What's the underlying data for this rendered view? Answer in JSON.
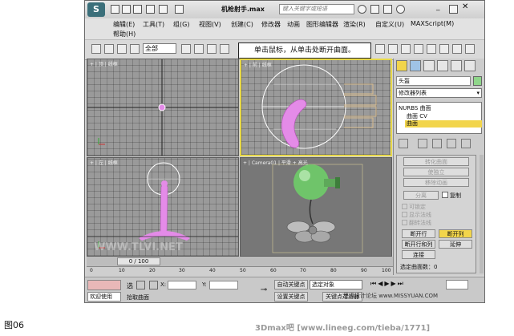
{
  "window": {
    "title": "机枪射手.max",
    "search_placeholder": "键入关键字或短语"
  },
  "menu": [
    "编辑(E)",
    "工具(T)",
    "组(G)",
    "视图(V)",
    "创建(C)",
    "修改器",
    "动画",
    "图形编辑器",
    "渲染(R)",
    "自定义(U)",
    "MAXScript(M)",
    "帮助(H)"
  ],
  "toolbar": {
    "selection_filter": "全部"
  },
  "callout": "单击鼠标，从单击处断开曲面。",
  "viewports": {
    "top": "+ | 顶 | 线框",
    "front": "+ | 前 | 线框",
    "left": "+ | 左 | 线框",
    "camera": "+ | Camera01 | 平滑 + 高光"
  },
  "panel": {
    "object_name": "头盔",
    "modifier_list": "修改器列表",
    "stack": [
      "NURBS 曲面",
      "曲面 CV",
      "曲面"
    ],
    "convert": "转化曲面",
    "make_independent": "使独立",
    "remove_anim": "移除动画",
    "detach": "分离",
    "copy": "复制",
    "check_1": "可锁定",
    "check_2": "显示法线",
    "check_3": "翻转法线",
    "break_row": "断开行",
    "break_col": "断开列",
    "break_both": "断开行和列",
    "extend": "延伸",
    "join": "连接",
    "selected_count": "选定曲面数：0"
  },
  "timeline": {
    "frame": "0 / 100",
    "ticks": [
      "0",
      "10",
      "20",
      "30",
      "40",
      "50",
      "60",
      "70",
      "80",
      "90",
      "100"
    ]
  },
  "status": {
    "welcome": "欢迎使用",
    "prompt": "拾取曲面",
    "select_label": "选",
    "x_label": "X:",
    "y_label": "Y:",
    "auto_key": "自动关键点",
    "selected": "选定对象",
    "set_key": "设置关键点",
    "key_filter": "关键点过滤器"
  },
  "caption": "图06",
  "watermarks": {
    "forum": "思缘设计论坛 www.MISSYUAN.COM",
    "site": "WWW.TLVI.NET",
    "bottom": "3Dmax吧 [www.lineeg.com/tieba/1771]"
  },
  "colors": {
    "active_border": "#e8d94a",
    "highlight": "#f2d54b",
    "nurbs_pink": "#e48be8",
    "vase_green": "#6fc46a"
  }
}
